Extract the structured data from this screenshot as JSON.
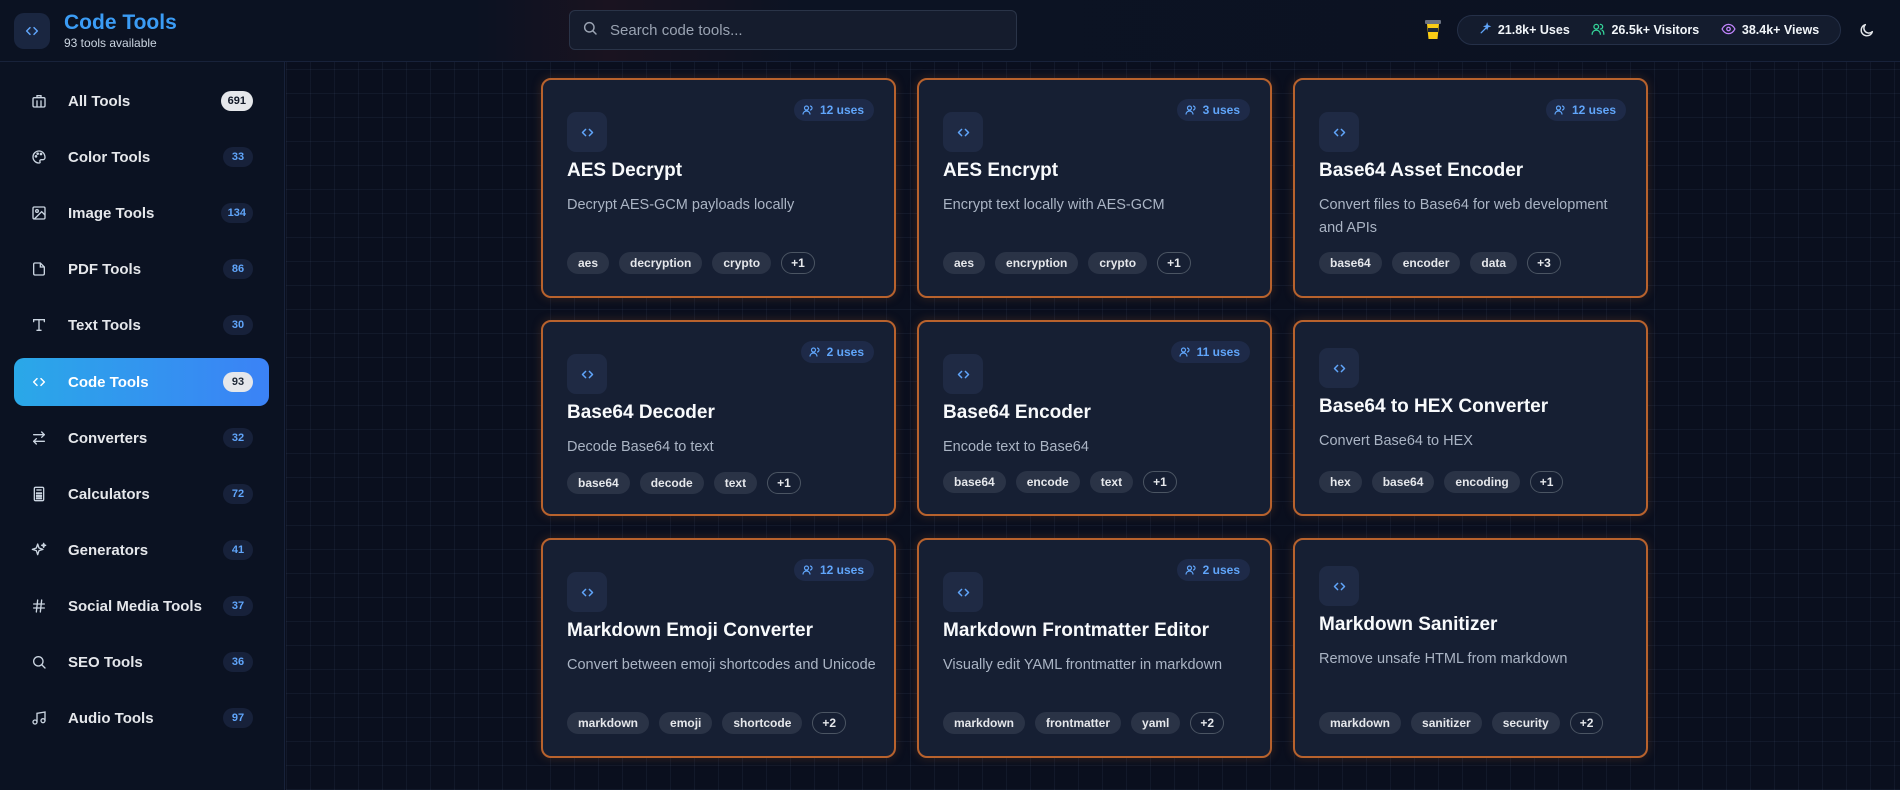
{
  "header": {
    "title": "Code Tools",
    "subtitle": "93 tools available",
    "search_placeholder": "Search code tools...",
    "stats": [
      {
        "label": "21.8k+ Uses",
        "icon": "wand-icon",
        "color": "#60a5fa"
      },
      {
        "label": "26.5k+ Visitors",
        "icon": "users-icon",
        "color": "#34d399"
      },
      {
        "label": "38.4k+ Views",
        "icon": "eye-icon",
        "color": "#c084fc"
      }
    ]
  },
  "sidebar": {
    "items": [
      {
        "label": "All Tools",
        "count": "691",
        "icon": "building-icon"
      },
      {
        "label": "Color Tools",
        "count": "33",
        "icon": "palette-icon"
      },
      {
        "label": "Image Tools",
        "count": "134",
        "icon": "image-icon"
      },
      {
        "label": "PDF Tools",
        "count": "86",
        "icon": "file-icon"
      },
      {
        "label": "Text Tools",
        "count": "30",
        "icon": "type-icon"
      },
      {
        "label": "Code Tools",
        "count": "93",
        "icon": "code-icon"
      },
      {
        "label": "Converters",
        "count": "32",
        "icon": "arrows-icon"
      },
      {
        "label": "Calculators",
        "count": "72",
        "icon": "calculator-icon"
      },
      {
        "label": "Generators",
        "count": "41",
        "icon": "sparkles-icon"
      },
      {
        "label": "Social Media Tools",
        "count": "37",
        "icon": "hash-icon"
      },
      {
        "label": "SEO Tools",
        "count": "36",
        "icon": "search-icon"
      },
      {
        "label": "Audio Tools",
        "count": "97",
        "icon": "music-icon"
      }
    ],
    "active_index": 5
  },
  "cards": [
    {
      "title": "AES Decrypt",
      "uses": "12 uses",
      "desc": "Decrypt AES-GCM payloads locally",
      "tags": [
        "aes",
        "decryption",
        "crypto"
      ],
      "more": "+1"
    },
    {
      "title": "AES Encrypt",
      "uses": "3 uses",
      "desc": "Encrypt text locally with AES-GCM",
      "tags": [
        "aes",
        "encryption",
        "crypto"
      ],
      "more": "+1"
    },
    {
      "title": "Base64 Asset Encoder",
      "uses": "12 uses",
      "desc": "Convert files to Base64 for web development and APIs",
      "tags": [
        "base64",
        "encoder",
        "data"
      ],
      "more": "+3"
    },
    {
      "title": "Base64 Decoder",
      "uses": "2 uses",
      "desc": "Decode Base64 to text",
      "tags": [
        "base64",
        "decode",
        "text"
      ],
      "more": "+1"
    },
    {
      "title": "Base64 Encoder",
      "uses": "11 uses",
      "desc": "Encode text to Base64",
      "tags": [
        "base64",
        "encode",
        "text"
      ],
      "more": "+1"
    },
    {
      "title": "Base64 to HEX Converter",
      "uses": "",
      "desc": "Convert Base64 to HEX",
      "tags": [
        "hex",
        "base64",
        "encoding"
      ],
      "more": "+1"
    },
    {
      "title": "Markdown Emoji Converter",
      "uses": "12 uses",
      "desc": "Convert between emoji shortcodes and Unicode",
      "tags": [
        "markdown",
        "emoji",
        "shortcode"
      ],
      "more": "+2"
    },
    {
      "title": "Markdown Frontmatter Editor",
      "uses": "2 uses",
      "desc": "Visually edit YAML frontmatter in markdown",
      "tags": [
        "markdown",
        "frontmatter",
        "yaml"
      ],
      "more": "+2"
    },
    {
      "title": "Markdown Sanitizer",
      "uses": "",
      "desc": "Remove unsafe HTML from markdown",
      "tags": [
        "markdown",
        "sanitizer",
        "security"
      ],
      "more": "+2"
    }
  ]
}
